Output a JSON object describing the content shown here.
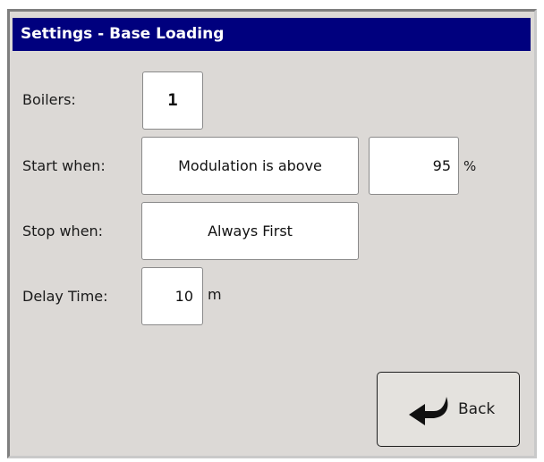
{
  "window": {
    "title": "Settings - Base Loading"
  },
  "rows": {
    "boilers": {
      "label": "Boilers:",
      "value": "1"
    },
    "start_when": {
      "label": "Start when:",
      "condition": "Modulation is above",
      "value": "95",
      "unit": "%"
    },
    "stop_when": {
      "label": "Stop when:",
      "condition": "Always First"
    },
    "delay_time": {
      "label": "Delay Time:",
      "value": "10",
      "unit": "m"
    }
  },
  "buttons": {
    "back": {
      "label": "Back",
      "icon": "return-arrow-icon"
    }
  },
  "colors": {
    "titlebar_bg": "#00007e",
    "panel_bg": "#dcd9d6",
    "field_bg": "#ffffff"
  }
}
